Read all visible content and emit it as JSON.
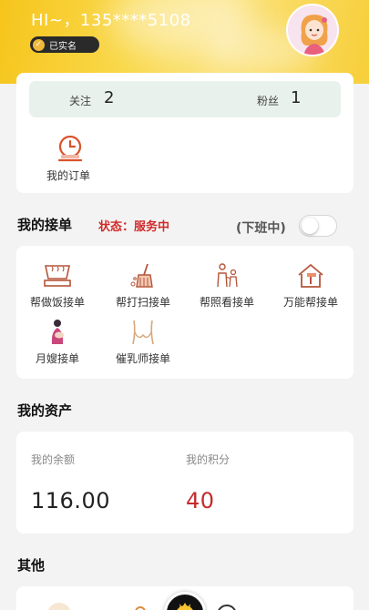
{
  "header": {
    "greeting": "HI~，135****5108",
    "verified_label": "已实名"
  },
  "stats": {
    "follow_label": "关注",
    "follow_count": "2",
    "fans_label": "粉丝",
    "fans_count": "1"
  },
  "orders": {
    "label": "我的订单"
  },
  "receiving": {
    "title": "我的接单",
    "status": "状态：服务中",
    "off_duty_label": "(下班中)",
    "toggle_on": false
  },
  "services": [
    {
      "label": "帮做饭接单",
      "icon": "stove-icon"
    },
    {
      "label": "帮打扫接单",
      "icon": "broom-icon"
    },
    {
      "label": "帮照看接单",
      "icon": "caregiver-icon"
    },
    {
      "label": "万能帮接单",
      "icon": "hammer-house-icon"
    },
    {
      "label": "月嫂接单",
      "icon": "mother-baby-icon"
    },
    {
      "label": "催乳师接单",
      "icon": "lactation-icon"
    }
  ],
  "assets": {
    "title": "我的资产",
    "balance_label": "我的余额",
    "balance_value": "116.00",
    "points_label": "我的积分",
    "points_value": "40"
  },
  "other": {
    "title": "其他"
  },
  "colors": {
    "header_yellow": "#f6c51c",
    "status_red": "#d12a2a",
    "points_red": "#c72a2a",
    "follow_bar": "#e9f1ec",
    "icon_orange": "#d9532b"
  }
}
